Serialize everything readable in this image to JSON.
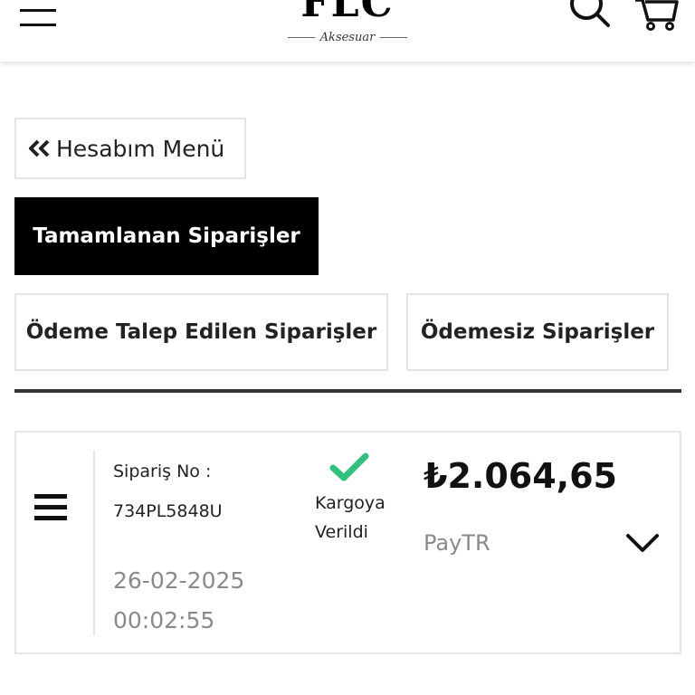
{
  "header": {
    "logo_main": "FLC",
    "logo_sub": "Aksesuar",
    "icons": [
      "hamburger-menu-icon",
      "search-icon",
      "cart-icon"
    ]
  },
  "back_button": {
    "label": "Hesabım Menü",
    "icon": "double-chevron-left-icon"
  },
  "tabs": [
    {
      "label": "Tamamlanan Siparişler",
      "active": true
    },
    {
      "label": "Ödeme Talep Edilen Siparişler",
      "active": false
    },
    {
      "label": "Ödemesiz Siparişler",
      "active": false
    }
  ],
  "order": {
    "no_label": "Sipariş No :",
    "no": "734PL5848U",
    "date": "26-02-2025",
    "time": "00:02:55",
    "status_line1": "Kargoya",
    "status_line2": "Verildi",
    "status_icon": "checkmark-icon",
    "status_color": "#2ec27e",
    "price": "₺2.064,65",
    "payment_method": "PayTR",
    "expand_icon": "chevron-down-icon"
  },
  "colors": {
    "active_tab_bg": "#000000",
    "border": "#e4e4e4",
    "muted_text": "#8a8a8a"
  }
}
